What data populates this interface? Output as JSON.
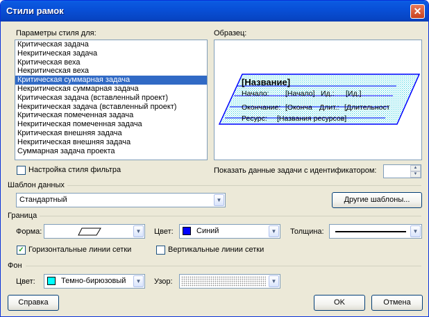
{
  "window": {
    "title": "Стили рамок",
    "close_label": "✕"
  },
  "style_params": {
    "label": "Параметры стиля для:",
    "items": [
      "Критическая задача",
      "Некритическая задача",
      "Критическая веха",
      "Некритическая веха",
      "Критическая суммарная задача",
      "Некритическая суммарная задача",
      "Критическая задача (вставленный проект)",
      "Некритическая задача (вставленный проект)",
      "Критическая помеченная задача",
      "Некритическая помеченная задача",
      "Критическая внешняя задача",
      "Некритическая внешняя задача",
      "Суммарная задача проекта"
    ],
    "selected_index": 4
  },
  "preview": {
    "label": "Образец:",
    "name": "[Название]",
    "row1_a": "Начало:",
    "row1_b": "[Начало]",
    "row1_c": "Ид.:",
    "row1_d": "[Ид.]",
    "row2_a": "Окончание:",
    "row2_b": "[Оконча",
    "row2_c": "Длит.:",
    "row2_d": "[Длительност",
    "row3_a": "Ресурс:",
    "row3_b": "[Названия ресурсов]"
  },
  "filter_style": {
    "label": "Настройка стиля фильтра",
    "checked": false
  },
  "show_task_data": {
    "label": "Показать данные задачи с идентификатором:",
    "value": ""
  },
  "data_template": {
    "section_label": "Шаблон данных",
    "value": "Стандартный",
    "other_templates_button": "Другие шаблоны..."
  },
  "border": {
    "section_label": "Граница",
    "shape_label": "Форма:",
    "color_label": "Цвет:",
    "color_value": "Синий",
    "color_hex": "#0000ff",
    "thickness_label": "Толщина:",
    "horizontal_grid": {
      "label": "Горизонтальные линии сетки",
      "checked": true
    },
    "vertical_grid": {
      "label": "Вертикальные линии сетки",
      "checked": false
    }
  },
  "background": {
    "section_label": "Фон",
    "color_label": "Цвет:",
    "color_value": "Темно-бирюзовый",
    "color_hex": "#00ffff",
    "pattern_label": "Узор:"
  },
  "buttons": {
    "help": "Справка",
    "ok": "OK",
    "cancel": "Отмена"
  },
  "icons": {
    "check": "✓",
    "dropdown": "▼",
    "spin_up": "▲",
    "spin_down": "▼"
  }
}
